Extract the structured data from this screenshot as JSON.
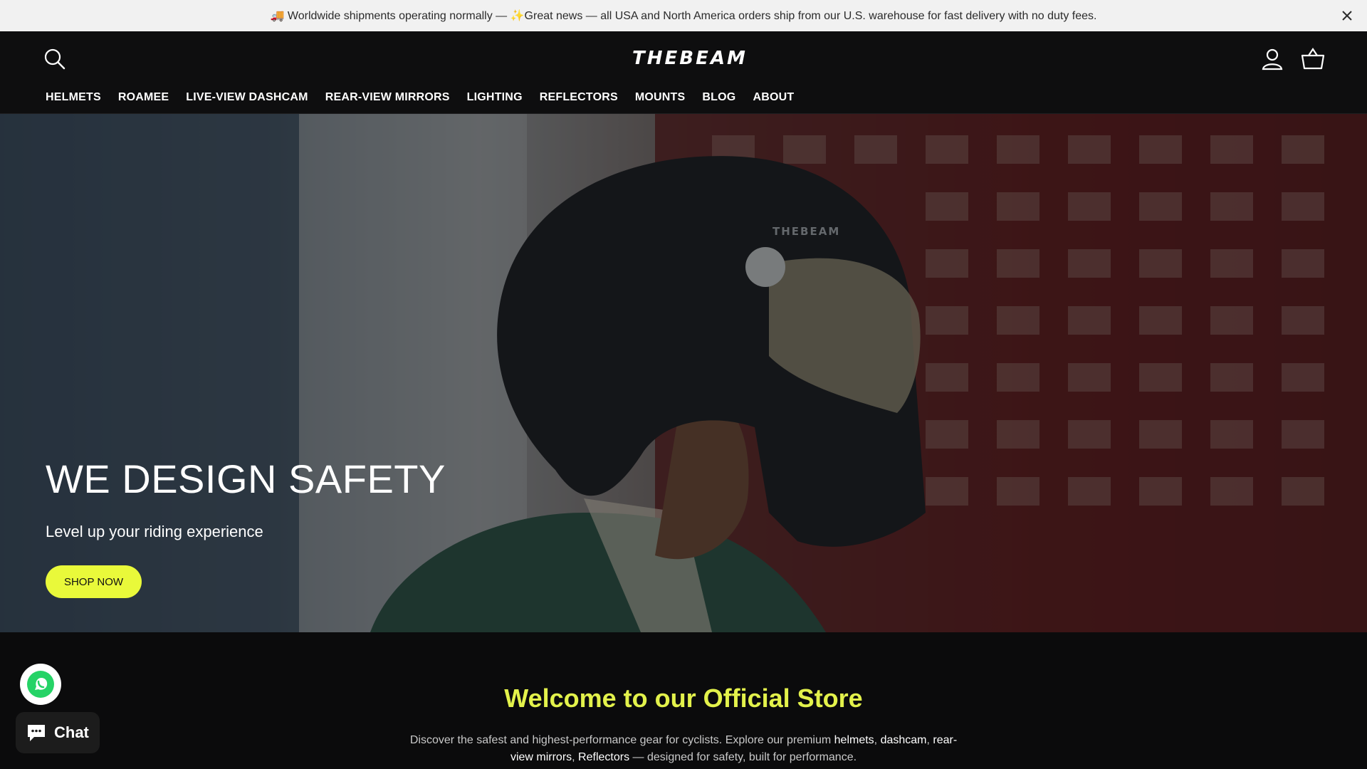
{
  "announcement": {
    "text": "🚚 Worldwide shipments operating normally — ✨Great news — all USA and North America orders ship from our U.S. warehouse for fast delivery with no duty fees.",
    "close_icon": "close-icon"
  },
  "header": {
    "logo": "THEBEAM",
    "search_icon": "search-icon",
    "account_icon": "account-icon",
    "cart_icon": "cart-icon",
    "nav": [
      "HELMETS",
      "ROAMEE",
      "LIVE-VIEW DASHCAM",
      "REAR-VIEW MIRRORS",
      "LIGHTING",
      "REFLECTORS",
      "MOUNTS",
      "BLOG",
      "ABOUT"
    ]
  },
  "hero": {
    "image_text": "THEBEAM",
    "title": "WE DESIGN SAFETY",
    "subtitle": "Level up your riding experience",
    "cta": "SHOP NOW",
    "cta_color": "#e9f93a"
  },
  "welcome": {
    "heading": "Welcome to our Official Store",
    "heading_color": "#e3f24b",
    "desc_1": "Discover the safest and highest-performance gear for cyclists. Explore our premium ",
    "link_helmets": "helmets",
    "sep_1": ", ",
    "link_dashcam": "dashcam",
    "sep_2": ", ",
    "link_mirrors": "rear-view mirrors",
    "sep_3": ", ",
    "link_reflectors": "Reflectors",
    "desc_2": " — designed for safety, built for performance."
  },
  "widgets": {
    "whatsapp_icon": "whatsapp-icon",
    "chat_label": "Chat",
    "chat_icon": "chat-bubble-icon"
  }
}
